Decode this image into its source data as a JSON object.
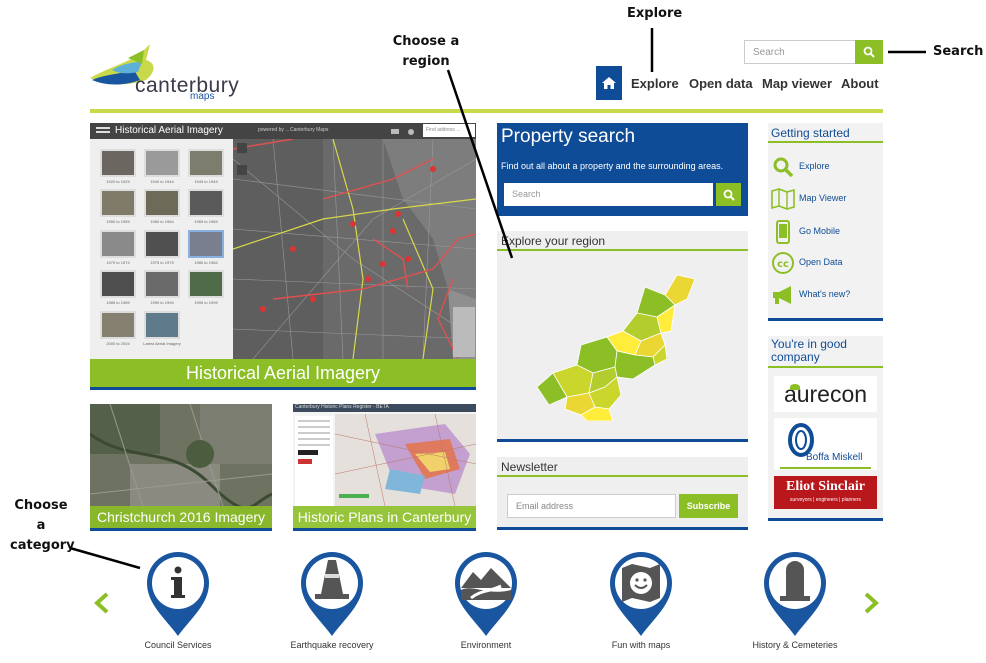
{
  "annotations": {
    "explore": "Explore",
    "search": "Search",
    "region": "Choose a region",
    "category": "Choose a category"
  },
  "header": {
    "logo_text": "canterbury",
    "logo_sub": "maps",
    "search_placeholder": "Search",
    "nav": [
      "Explore",
      "Open data",
      "Map viewer",
      "About"
    ]
  },
  "hero": {
    "window_title": "Historical Aerial Imagery",
    "powered_by": "powered by ...",
    "brand_small": "Canterbury Maps",
    "find_placeholder": "Find address ...",
    "caption": "Historical Aerial Imagery",
    "thumbs": [
      "1920 to 1929",
      "1940 to 1944",
      "1945 to 1949",
      "1950 to 1959",
      "1960 to 1964",
      "1965 to 1969",
      "1970 to 1974",
      "1975 to 1979",
      "1980 to 1984",
      "1985 to 1989",
      "1990 to 1994",
      "1995 to 1999",
      "2000 to 2004",
      "Latest Aerial Imagery"
    ]
  },
  "cards": [
    {
      "caption": "Christchurch 2016 Imagery"
    },
    {
      "caption": "Historic Plans in Canterbury",
      "window_title": "Canterbury Historic Plans Register - BETA"
    }
  ],
  "property": {
    "title": "Property search",
    "subtitle": "Find out all about a property and the surrounding areas.",
    "placeholder": "Search"
  },
  "region": {
    "title": "Explore your region"
  },
  "newsletter": {
    "title": "Newsletter",
    "placeholder": "Email address",
    "button": "Subscribe"
  },
  "getting_started": {
    "title": "Getting started",
    "items": [
      {
        "label": "Explore",
        "icon": "magnifier-icon"
      },
      {
        "label": "Map Viewer",
        "icon": "map-icon"
      },
      {
        "label": "Go Mobile",
        "icon": "mobile-icon"
      },
      {
        "label": "Open Data",
        "icon": "creative-commons-icon"
      },
      {
        "label": "What's new?",
        "icon": "megaphone-icon"
      }
    ]
  },
  "company": {
    "title": "You're in good company",
    "logos": [
      "aurecon",
      "Boffa Miskell",
      "Eliot Sinclair",
      "surveyors | engineers | planners"
    ]
  },
  "categories": [
    {
      "label": "Council Services",
      "icon": "info-icon"
    },
    {
      "label": "Earthquake recovery",
      "icon": "road-cone-icon"
    },
    {
      "label": "Environment",
      "icon": "landscape-icon"
    },
    {
      "label": "Fun with maps",
      "icon": "smiley-map-icon"
    },
    {
      "label": "History & Cemeteries",
      "icon": "headstone-icon"
    }
  ],
  "colors": {
    "brand_blue": "#0f4c97",
    "brand_green": "#8cbf26",
    "rule_green": "#c9d94a"
  }
}
